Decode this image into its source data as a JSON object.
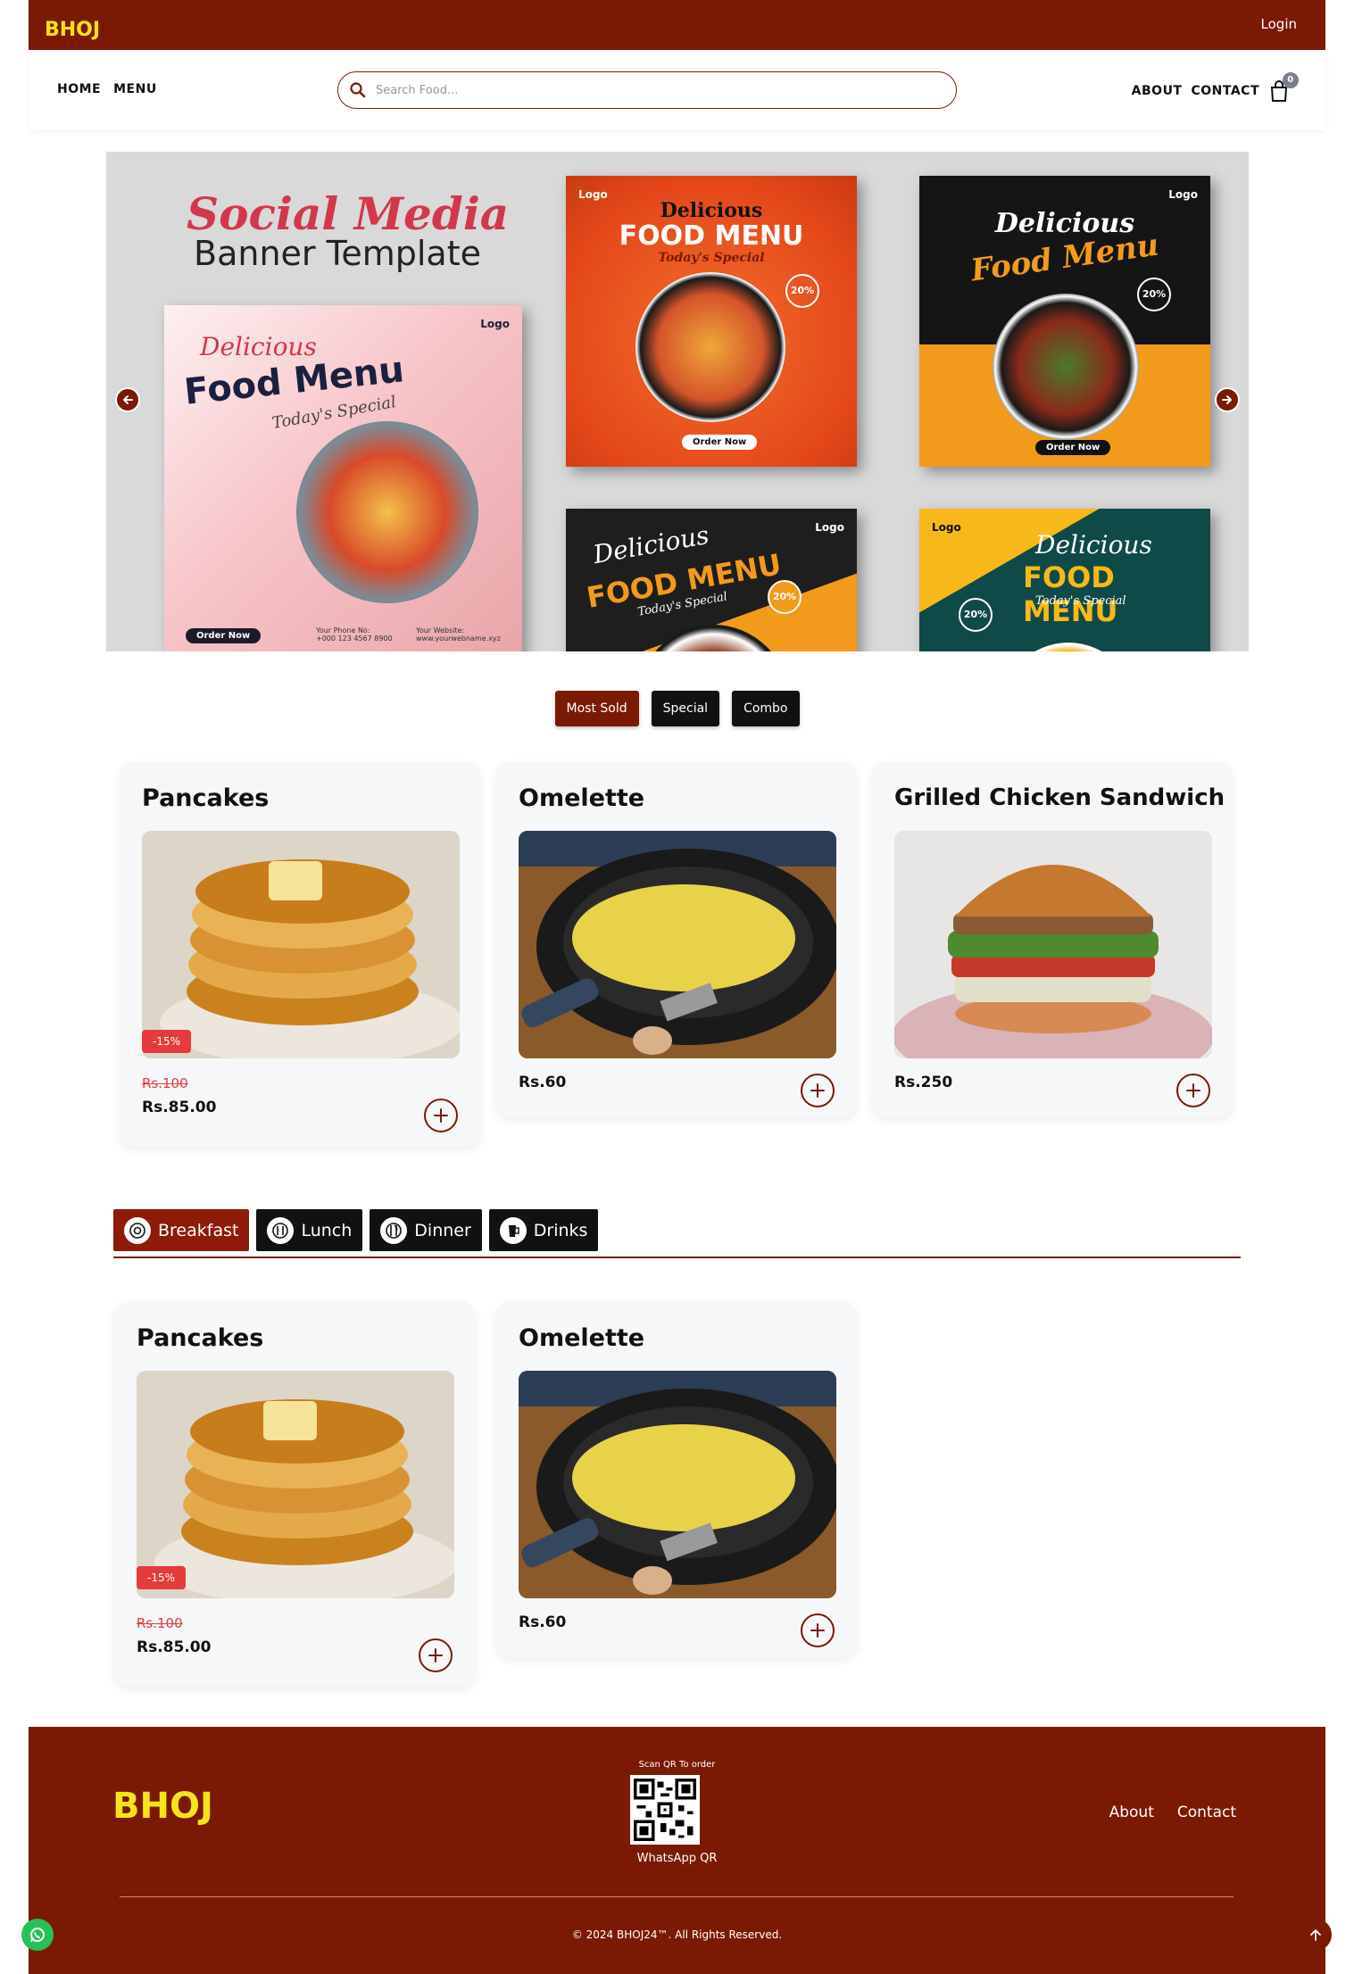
{
  "header": {
    "logo_text": "BHOJ",
    "login_label": "Login"
  },
  "nav": {
    "left": [
      "HOME",
      "MENU"
    ],
    "right": [
      "ABOUT",
      "CONTACT"
    ],
    "cart_count": "0",
    "search_placeholder": "Search Food..."
  },
  "hero": {
    "title_line1": "Social Media",
    "title_line2": "Banner Template",
    "banners": [
      {
        "heading": "Delicious",
        "sub": "Food Menu",
        "tagline": "Today's Special",
        "logo": "Logo",
        "button": "Order Now",
        "phone_label": "Your Phone No:",
        "phone": "+000 123 4567 8900",
        "web_label": "Your Website:",
        "web": "www.yourwebname.xyz"
      },
      {
        "heading": "Delicious",
        "sub": "FOOD MENU",
        "tagline": "Today's Special",
        "logo": "Logo",
        "button": "Order Now",
        "badge": "20%"
      },
      {
        "heading": "Delicious",
        "sub": "Food Menu",
        "logo": "Logo",
        "button": "Order Now",
        "badge": "20%"
      },
      {
        "heading": "Delicious",
        "sub": "FOOD MENU",
        "tagline": "Today's Special",
        "logo": "Logo",
        "badge": "20%"
      },
      {
        "heading": "Delicious",
        "sub": "FOOD MENU",
        "tagline": "Today's Special",
        "logo": "Logo",
        "badge": "20%"
      }
    ]
  },
  "filters": [
    {
      "label": "Most Sold",
      "active": true
    },
    {
      "label": "Special",
      "active": false
    },
    {
      "label": "Combo",
      "active": false
    }
  ],
  "featured": [
    {
      "name": "Pancakes",
      "discount": "-15%",
      "old_price": "Rs.100",
      "price": "Rs.85.00"
    },
    {
      "name": "Omelette",
      "price": "Rs.60"
    },
    {
      "name": "Grilled Chicken Sandwich",
      "price": "Rs.250"
    }
  ],
  "categories": [
    {
      "label": "Breakfast",
      "active": true
    },
    {
      "label": "Lunch",
      "active": false
    },
    {
      "label": "Dinner",
      "active": false
    },
    {
      "label": "Drinks",
      "active": false
    }
  ],
  "category_items": [
    {
      "name": "Pancakes",
      "discount": "-15%",
      "old_price": "Rs.100",
      "price": "Rs.85.00"
    },
    {
      "name": "Omelette",
      "price": "Rs.60"
    }
  ],
  "footer": {
    "logo_text": "BHOJ",
    "qr_top": "Scan QR To order",
    "qr_bottom": "WhatsApp QR",
    "links": [
      "About",
      "Contact"
    ],
    "copyright": "© 2024 BHOJ24™. All Rights Reserved."
  },
  "colors": {
    "brand": "#7a1a05",
    "discount": "#e43c3c",
    "whatsapp": "#27c157"
  }
}
